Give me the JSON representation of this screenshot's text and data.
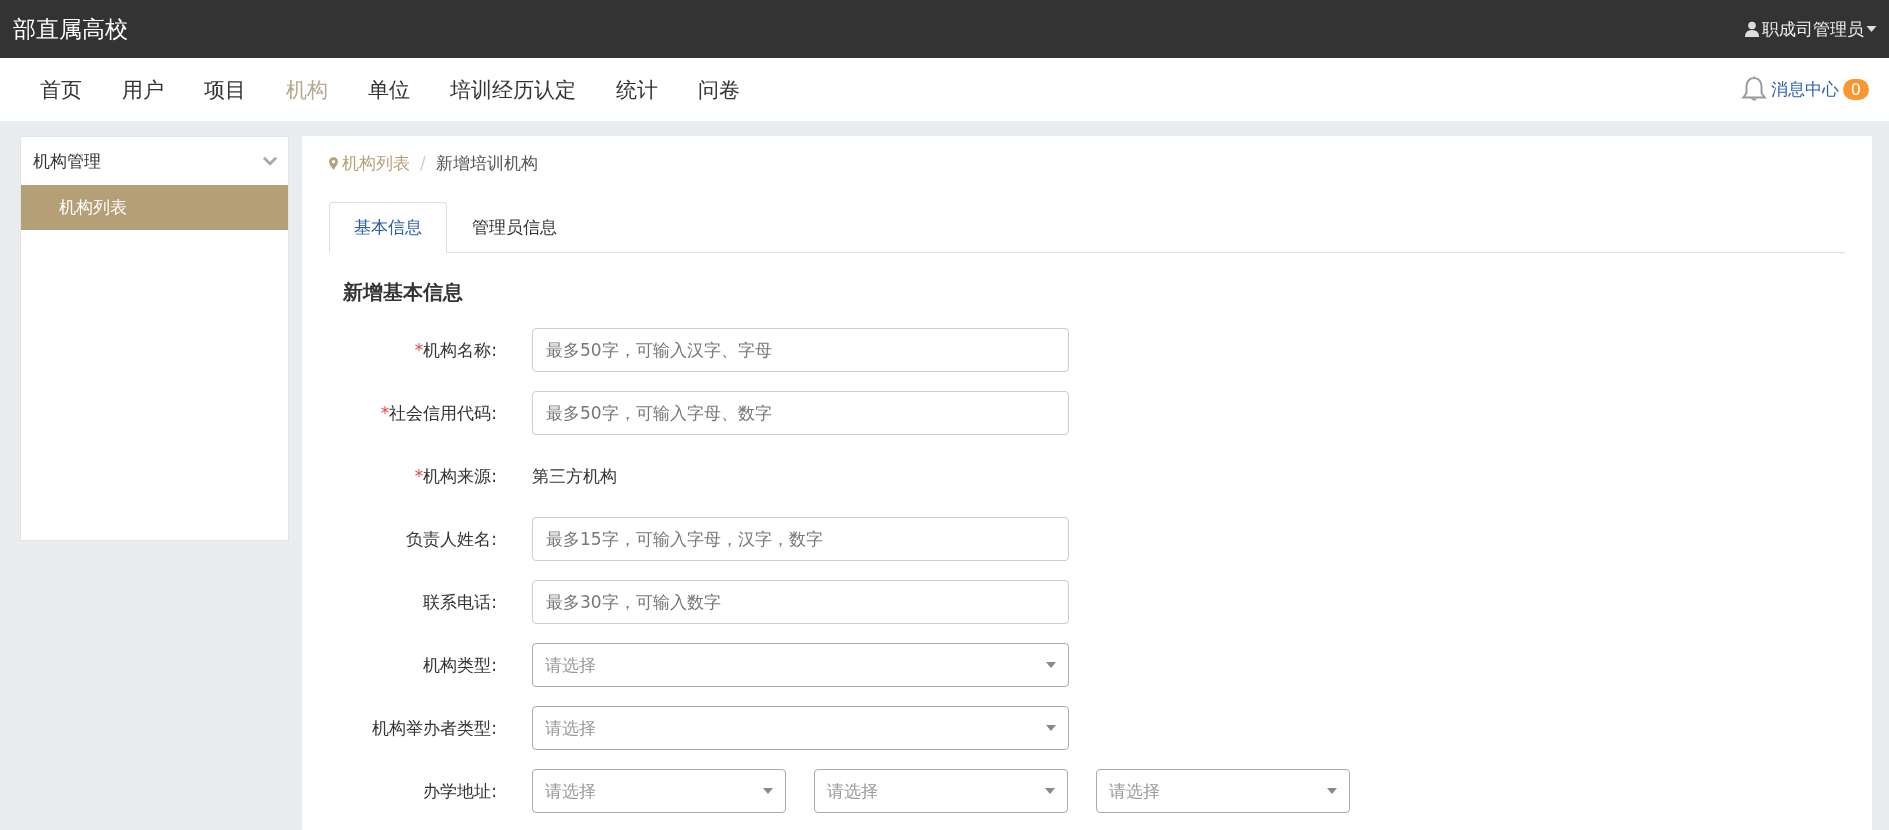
{
  "header": {
    "title": "部直属高校",
    "user": "职成司管理员"
  },
  "nav": {
    "items": [
      {
        "label": "首页",
        "selected": false
      },
      {
        "label": "用户",
        "selected": false
      },
      {
        "label": "项目",
        "selected": false
      },
      {
        "label": "机构",
        "selected": true
      },
      {
        "label": "单位",
        "selected": false
      },
      {
        "label": "培训经历认定",
        "selected": false
      },
      {
        "label": "统计",
        "selected": false
      },
      {
        "label": "问卷",
        "selected": false
      }
    ],
    "messages": {
      "label": "消息中心",
      "count": "0"
    }
  },
  "sidebar": {
    "group": {
      "label": "机构管理",
      "expanded": true,
      "items": [
        {
          "label": "机构列表",
          "selected": true
        }
      ]
    }
  },
  "breadcrumb": {
    "separator": "/",
    "items": [
      "机构列表",
      "新增培训机构"
    ]
  },
  "tabs": [
    {
      "label": "基本信息",
      "selected": true
    },
    {
      "label": "管理员信息",
      "selected": false
    }
  ],
  "form": {
    "title": "新增基本信息",
    "required_mark": "*",
    "fields": [
      {
        "kind": "input",
        "label": "机构名称:",
        "required": true,
        "placeholder": "最多50字，可输入汉字、字母"
      },
      {
        "kind": "input",
        "label": "社会信用代码:",
        "required": true,
        "placeholder": "最多50字，可输入字母、数字"
      },
      {
        "kind": "text",
        "label": "机构来源:",
        "required": true,
        "value": "第三方机构"
      },
      {
        "kind": "input",
        "label": "负责人姓名:",
        "required": false,
        "placeholder": "最多15字，可输入字母，汉字，数字"
      },
      {
        "kind": "input",
        "label": "联系电话:",
        "required": false,
        "placeholder": "最多30字，可输入数字"
      },
      {
        "kind": "select",
        "label": "机构类型:",
        "required": false,
        "placeholder": "请选择"
      },
      {
        "kind": "select",
        "label": "机构举办者类型:",
        "required": false,
        "placeholder": "请选择"
      },
      {
        "kind": "selects",
        "label": "办学地址:",
        "required": false,
        "placeholders": [
          "请选择",
          "请选择",
          "请选择"
        ]
      }
    ]
  }
}
